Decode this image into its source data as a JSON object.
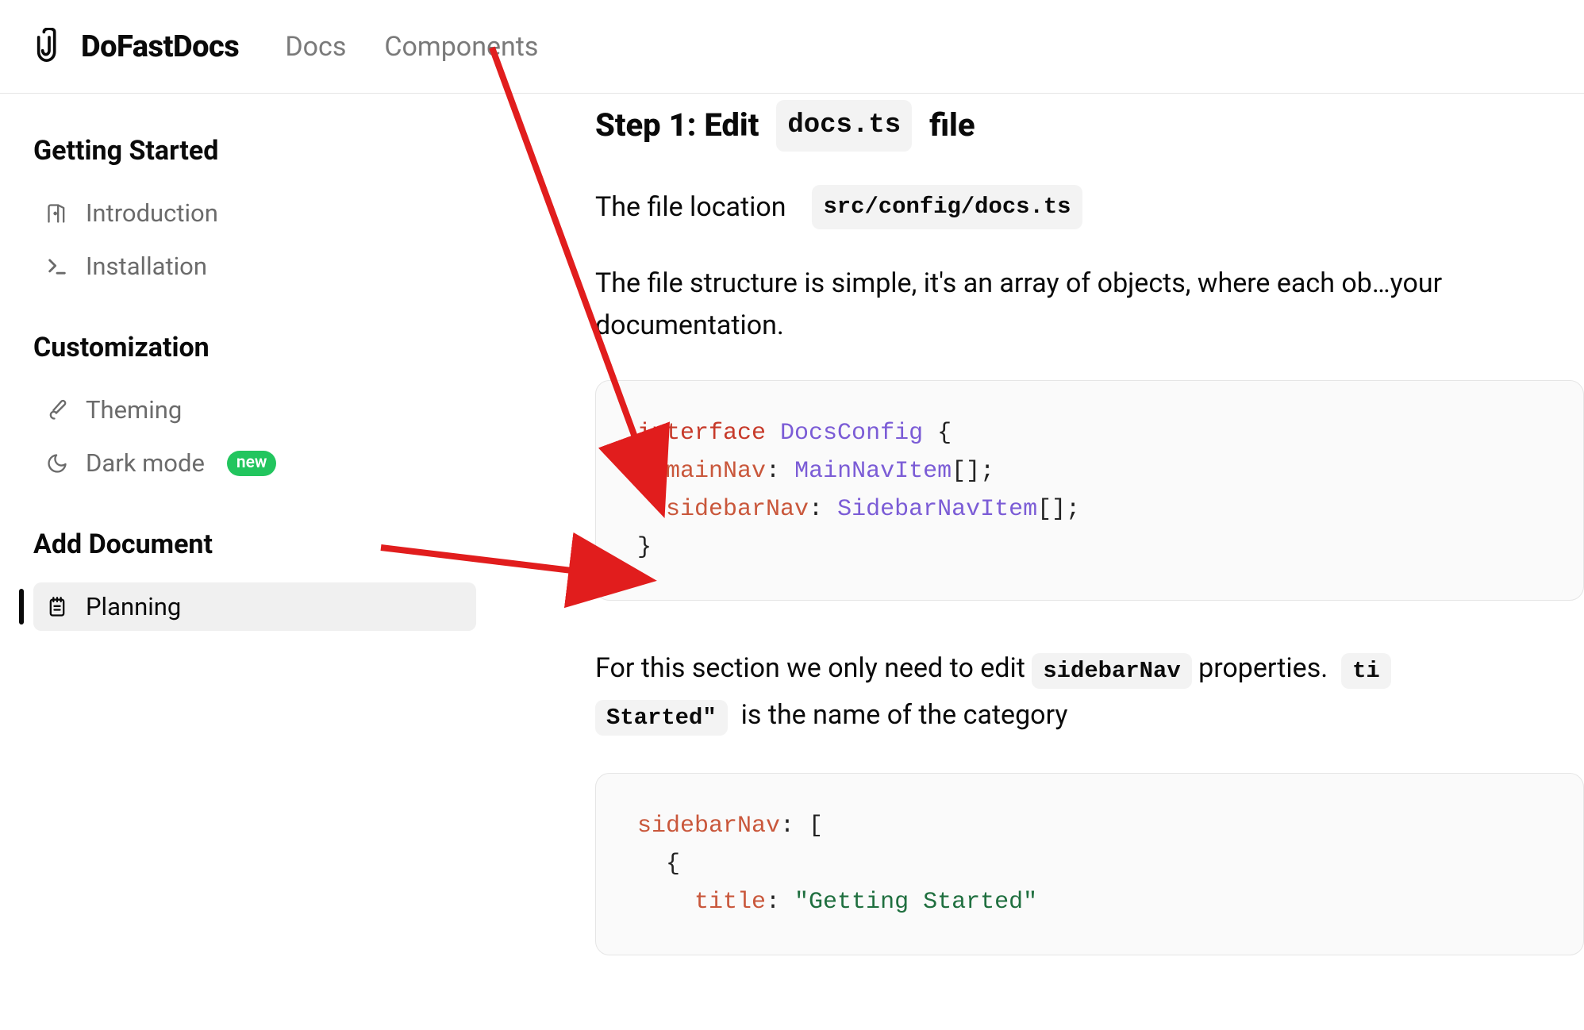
{
  "header": {
    "brand": "DoFastDocs",
    "nav": {
      "docs": "Docs",
      "components": "Components"
    }
  },
  "sidebar": {
    "sections": [
      {
        "title": "Getting Started",
        "items": [
          {
            "icon": "door-icon",
            "label": "Introduction"
          },
          {
            "icon": "terminal-icon",
            "label": "Installation"
          }
        ]
      },
      {
        "title": "Customization",
        "items": [
          {
            "icon": "brush-icon",
            "label": "Theming"
          },
          {
            "icon": "moon-icon",
            "label": "Dark mode",
            "badge": "new"
          }
        ]
      },
      {
        "title": "Add Document",
        "items": [
          {
            "icon": "notepad-icon",
            "label": "Planning",
            "active": true
          }
        ]
      }
    ]
  },
  "main": {
    "step_heading_prefix": "Step 1: Edit",
    "step_heading_code": "docs.ts",
    "step_heading_suffix": "file",
    "p1_text": "The file location",
    "p1_code": "src/config/docs.ts",
    "p2": "The file structure is simple, it's an array of objects, where each ob…your documentation.",
    "code1": {
      "l1_kw": "interface",
      "l1_type": "DocsConfig",
      "l1_brace": "{",
      "l2_prop": "mainNav",
      "l2_type": "MainNavItem",
      "l2_rest": "[];",
      "l3_prop": "sidebarNav",
      "l3_type": "SidebarNavItem",
      "l3_rest": "[];",
      "l4": "}"
    },
    "p3_a": "For this section we only need to edit",
    "p3_code1": "sidebarNav",
    "p3_b": "properties.",
    "p3_code2": "ti",
    "p3_code3": "Started\"",
    "p3_c": "is the name of the category",
    "code2": {
      "l1_prop": "sidebarNav",
      "l1_rest": ": [",
      "l2": "{",
      "l3_prop": "title",
      "l3_str": "\"Getting Started\""
    }
  }
}
